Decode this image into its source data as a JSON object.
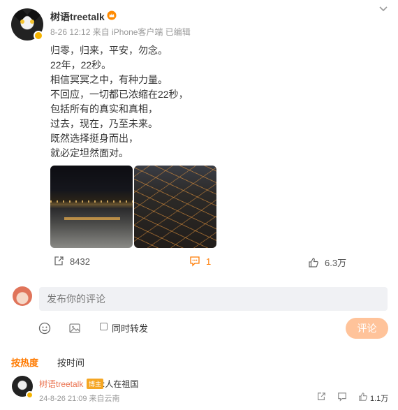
{
  "post": {
    "author": "树语treetalk",
    "meta": "8-26 12:12  来自 iPhone客户端  已编辑",
    "lines": [
      "归零，归来，平安，勿念。",
      "22年，22秒。",
      "相信冥冥之中，有种力量。",
      "不回应，一切都已浓缩在22秒，",
      "包括所有的真实和真相，",
      "过去，现在，乃至未来。",
      "既然选择挺身而出，",
      "就必定坦然面对。"
    ],
    "actions": {
      "repost": "8432",
      "comment": "1",
      "like": "6.3万"
    }
  },
  "compose": {
    "placeholder": "发布你的评论",
    "also_repost": "同时转发",
    "submit": "评论"
  },
  "sort": {
    "hot": "按热度",
    "time": "按时间"
  },
  "reply": {
    "user": "树语treetalk",
    "badge": "博主",
    "text": ":人在祖国",
    "meta": "24-8-26 21:09  来自云南",
    "likes": "1.1万"
  },
  "colors": {
    "accent": "#ff7a00",
    "submit_bg": "#ffc39a",
    "username_link": "#eb7350"
  }
}
